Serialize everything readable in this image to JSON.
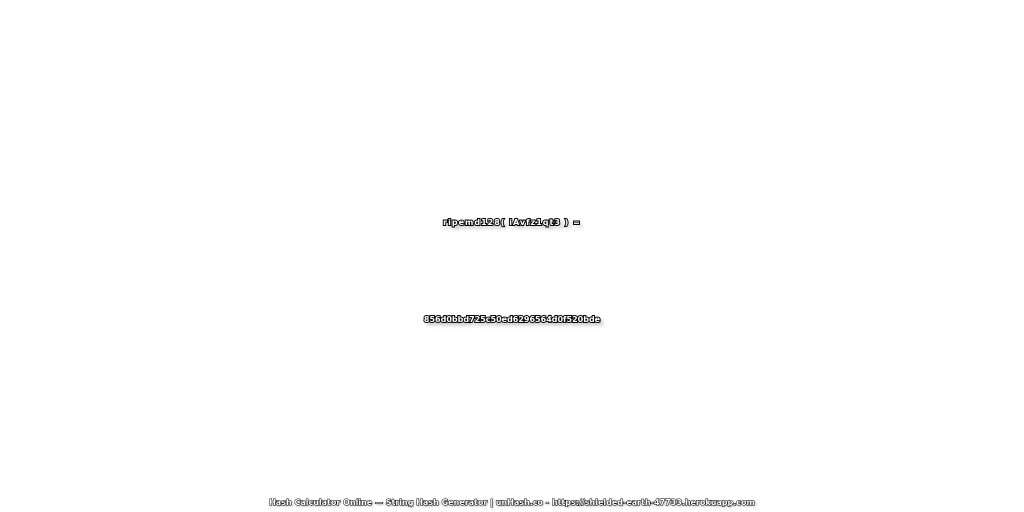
{
  "headline": {
    "expression": "ripemd128( iAvfz1qt3 ) =",
    "hash": "856d0bbd725c50ed6296564d0f520bde"
  },
  "footer": {
    "credit": "Hash Calculator Online — String Hash Generator | unHash.co - https://shielded-earth-47733.herokuapp.com"
  },
  "colors": {
    "background": "#ffffff",
    "text_fill": "#ffffff",
    "text_outline": "#000000"
  }
}
